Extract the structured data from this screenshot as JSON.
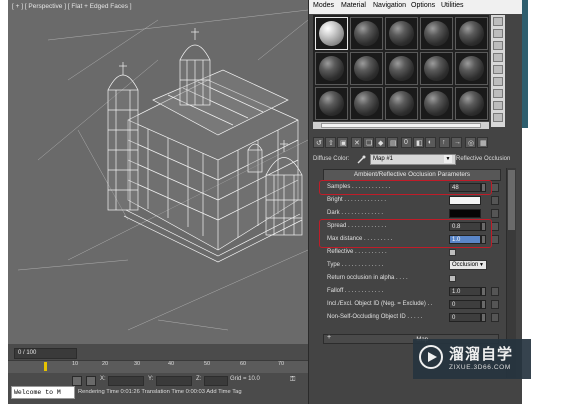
{
  "viewport": {
    "label": "[ + ] [ Perspective ] [ Flat + Edged Faces ]"
  },
  "timeline": {
    "frame_counter": "0 / 100",
    "ticks": [
      "10",
      "20",
      "30",
      "40",
      "50",
      "60",
      "70"
    ],
    "coord_labels": [
      "X:",
      "Y:",
      "Z:"
    ],
    "grid": "Grid = 10.0",
    "welcome": "Welcome to M",
    "status": "Rendering Time  0:01:26     Translation Time  0:00:03     Add Time Tag"
  },
  "material_editor": {
    "menu": [
      "Modes",
      "Material",
      "Navigation",
      "Options",
      "Utilities"
    ],
    "slots_rows": 3,
    "slots_cols": 5,
    "selected_slot": 0,
    "toolbar_icons": [
      "get-material-icon",
      "put-to-scene-icon",
      "assign-icon",
      "reset-icon",
      "make-copy-icon",
      "make-unique-icon",
      "put-library-icon",
      "effects-channel-icon",
      "show-map-icon",
      "show-end-result-icon",
      "go-parent-icon",
      "go-sibling-icon",
      "pick-icon",
      "copy-icon"
    ],
    "diffuse_label": "Diffuse Color:",
    "map_name": "Map #1",
    "map_type": "Reflective Occlusion",
    "rollout_title": "Ambient/Reflective Occlusion Parameters",
    "params": [
      {
        "label": "Samples . . . . . . . . . . . .",
        "kind": "spinner",
        "value": "48",
        "selected": false
      },
      {
        "label": "Bright . . . . . . . . . . . . .",
        "kind": "swatch",
        "color": "#f4f4f4"
      },
      {
        "label": "Dark . . . . . . . . . . . . .",
        "kind": "swatch",
        "color": "#050505"
      },
      {
        "label": "Spread . . . . . . . . . . . .",
        "kind": "spinner",
        "value": "0.8",
        "selected": false
      },
      {
        "label": "Max distance . . . . . . . . .",
        "kind": "spinner",
        "value": "1.0",
        "selected": true
      },
      {
        "label": "Reflective . . . . . . . . . .",
        "kind": "check"
      },
      {
        "label": "Type . . . . . . . . . . . . .",
        "kind": "select",
        "value": "Occlusion"
      },
      {
        "label": "Return occlusion in alpha . . . .",
        "kind": "check"
      },
      {
        "label": "Falloff . . . . . . . . . . . .",
        "kind": "spinner",
        "value": "1.0",
        "selected": false
      },
      {
        "label": "Incl./Excl. Object ID (Neg. = Exclude) . .",
        "kind": "spinner",
        "value": "0",
        "selected": false
      },
      {
        "label": "Non-Self-Occluding Object ID . . . . .",
        "kind": "spinner",
        "value": "0",
        "selected": false
      }
    ],
    "maps_label": "Map"
  },
  "watermark": {
    "title": "溜溜自学",
    "subtitle": "ZIXUE.3D66.COM"
  },
  "colors": {
    "viewport_bg": "#6a6a6a",
    "wire": "#f2f2f2",
    "highlight": "#c01c28",
    "selection_blue": "#5a86c8"
  }
}
